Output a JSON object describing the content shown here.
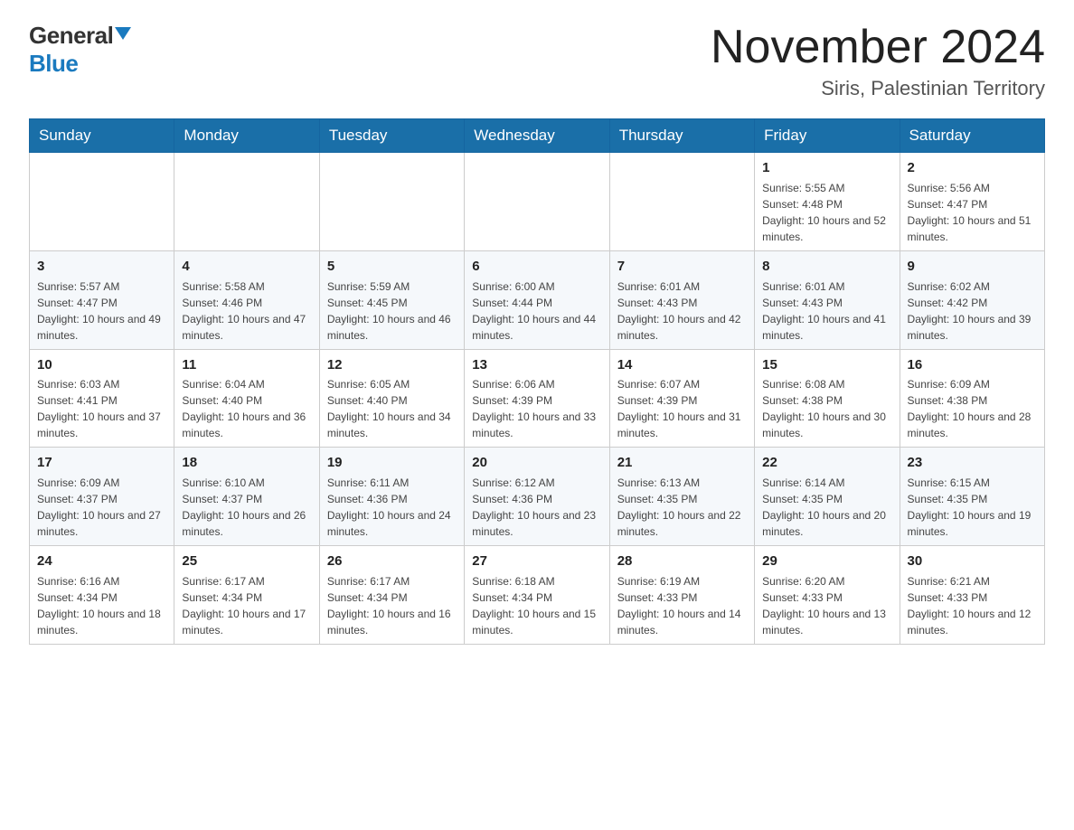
{
  "logo": {
    "general": "General",
    "blue": "Blue"
  },
  "header": {
    "month": "November 2024",
    "location": "Siris, Palestinian Territory"
  },
  "weekdays": [
    "Sunday",
    "Monday",
    "Tuesday",
    "Wednesday",
    "Thursday",
    "Friday",
    "Saturday"
  ],
  "weeks": [
    [
      {
        "day": "",
        "info": ""
      },
      {
        "day": "",
        "info": ""
      },
      {
        "day": "",
        "info": ""
      },
      {
        "day": "",
        "info": ""
      },
      {
        "day": "",
        "info": ""
      },
      {
        "day": "1",
        "info": "Sunrise: 5:55 AM\nSunset: 4:48 PM\nDaylight: 10 hours and 52 minutes."
      },
      {
        "day": "2",
        "info": "Sunrise: 5:56 AM\nSunset: 4:47 PM\nDaylight: 10 hours and 51 minutes."
      }
    ],
    [
      {
        "day": "3",
        "info": "Sunrise: 5:57 AM\nSunset: 4:47 PM\nDaylight: 10 hours and 49 minutes."
      },
      {
        "day": "4",
        "info": "Sunrise: 5:58 AM\nSunset: 4:46 PM\nDaylight: 10 hours and 47 minutes."
      },
      {
        "day": "5",
        "info": "Sunrise: 5:59 AM\nSunset: 4:45 PM\nDaylight: 10 hours and 46 minutes."
      },
      {
        "day": "6",
        "info": "Sunrise: 6:00 AM\nSunset: 4:44 PM\nDaylight: 10 hours and 44 minutes."
      },
      {
        "day": "7",
        "info": "Sunrise: 6:01 AM\nSunset: 4:43 PM\nDaylight: 10 hours and 42 minutes."
      },
      {
        "day": "8",
        "info": "Sunrise: 6:01 AM\nSunset: 4:43 PM\nDaylight: 10 hours and 41 minutes."
      },
      {
        "day": "9",
        "info": "Sunrise: 6:02 AM\nSunset: 4:42 PM\nDaylight: 10 hours and 39 minutes."
      }
    ],
    [
      {
        "day": "10",
        "info": "Sunrise: 6:03 AM\nSunset: 4:41 PM\nDaylight: 10 hours and 37 minutes."
      },
      {
        "day": "11",
        "info": "Sunrise: 6:04 AM\nSunset: 4:40 PM\nDaylight: 10 hours and 36 minutes."
      },
      {
        "day": "12",
        "info": "Sunrise: 6:05 AM\nSunset: 4:40 PM\nDaylight: 10 hours and 34 minutes."
      },
      {
        "day": "13",
        "info": "Sunrise: 6:06 AM\nSunset: 4:39 PM\nDaylight: 10 hours and 33 minutes."
      },
      {
        "day": "14",
        "info": "Sunrise: 6:07 AM\nSunset: 4:39 PM\nDaylight: 10 hours and 31 minutes."
      },
      {
        "day": "15",
        "info": "Sunrise: 6:08 AM\nSunset: 4:38 PM\nDaylight: 10 hours and 30 minutes."
      },
      {
        "day": "16",
        "info": "Sunrise: 6:09 AM\nSunset: 4:38 PM\nDaylight: 10 hours and 28 minutes."
      }
    ],
    [
      {
        "day": "17",
        "info": "Sunrise: 6:09 AM\nSunset: 4:37 PM\nDaylight: 10 hours and 27 minutes."
      },
      {
        "day": "18",
        "info": "Sunrise: 6:10 AM\nSunset: 4:37 PM\nDaylight: 10 hours and 26 minutes."
      },
      {
        "day": "19",
        "info": "Sunrise: 6:11 AM\nSunset: 4:36 PM\nDaylight: 10 hours and 24 minutes."
      },
      {
        "day": "20",
        "info": "Sunrise: 6:12 AM\nSunset: 4:36 PM\nDaylight: 10 hours and 23 minutes."
      },
      {
        "day": "21",
        "info": "Sunrise: 6:13 AM\nSunset: 4:35 PM\nDaylight: 10 hours and 22 minutes."
      },
      {
        "day": "22",
        "info": "Sunrise: 6:14 AM\nSunset: 4:35 PM\nDaylight: 10 hours and 20 minutes."
      },
      {
        "day": "23",
        "info": "Sunrise: 6:15 AM\nSunset: 4:35 PM\nDaylight: 10 hours and 19 minutes."
      }
    ],
    [
      {
        "day": "24",
        "info": "Sunrise: 6:16 AM\nSunset: 4:34 PM\nDaylight: 10 hours and 18 minutes."
      },
      {
        "day": "25",
        "info": "Sunrise: 6:17 AM\nSunset: 4:34 PM\nDaylight: 10 hours and 17 minutes."
      },
      {
        "day": "26",
        "info": "Sunrise: 6:17 AM\nSunset: 4:34 PM\nDaylight: 10 hours and 16 minutes."
      },
      {
        "day": "27",
        "info": "Sunrise: 6:18 AM\nSunset: 4:34 PM\nDaylight: 10 hours and 15 minutes."
      },
      {
        "day": "28",
        "info": "Sunrise: 6:19 AM\nSunset: 4:33 PM\nDaylight: 10 hours and 14 minutes."
      },
      {
        "day": "29",
        "info": "Sunrise: 6:20 AM\nSunset: 4:33 PM\nDaylight: 10 hours and 13 minutes."
      },
      {
        "day": "30",
        "info": "Sunrise: 6:21 AM\nSunset: 4:33 PM\nDaylight: 10 hours and 12 minutes."
      }
    ]
  ]
}
